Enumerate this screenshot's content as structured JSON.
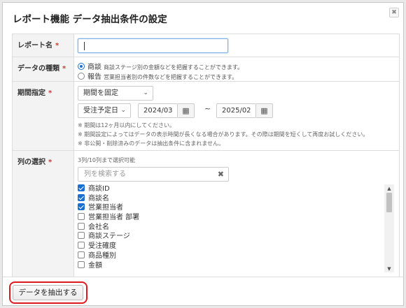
{
  "dialog": {
    "title": "レポート機能 データ抽出条件の設定",
    "close_label": "✖"
  },
  "form": {
    "report_name": {
      "label": "レポート名",
      "required_mark": "*",
      "value": ""
    },
    "data_type": {
      "label": "データの種類",
      "required_mark": "*",
      "options": [
        {
          "name": "商談",
          "description": "商談ステージ別の金額などを把握することができます。",
          "selected": true
        },
        {
          "name": "報告",
          "description": "営業担当者別の件数などを把握することができます。",
          "selected": false
        }
      ]
    },
    "period": {
      "label": "期間指定",
      "required_mark": "*",
      "mode": "期間を固定",
      "date_field": "受注予定日",
      "from": "2024/03",
      "separator": "~",
      "to": "2025/02",
      "notes": [
        "※ 期間は12ヶ月以内にしてください。",
        "※ 期間設定によってはデータの表示時間が長くなる場合があります。その際は期間を短くして再度お試しください。",
        "※ 非公開・削除済みのデータは抽出条件に含まれません。"
      ]
    },
    "columns": {
      "label": "列の選択",
      "required_mark": "*",
      "hint": "3列/10列まで選択可能",
      "search_placeholder": "列を検索する",
      "search_clear": "✖",
      "items": [
        {
          "label": "商談ID",
          "checked": true
        },
        {
          "label": "商談名",
          "checked": true
        },
        {
          "label": "営業担当者",
          "checked": true
        },
        {
          "label": "営業担当者 部署",
          "checked": false
        },
        {
          "label": "会社名",
          "checked": false
        },
        {
          "label": "商談ステージ",
          "checked": false
        },
        {
          "label": "受注確度",
          "checked": false
        },
        {
          "label": "商品種別",
          "checked": false
        },
        {
          "label": "金額",
          "checked": false
        }
      ]
    }
  },
  "footer": {
    "extract_button": "データを抽出する"
  },
  "colors": {
    "accent": "#1a6fd0",
    "required": "#dd3333",
    "highlight_frame": "#e0191e"
  }
}
